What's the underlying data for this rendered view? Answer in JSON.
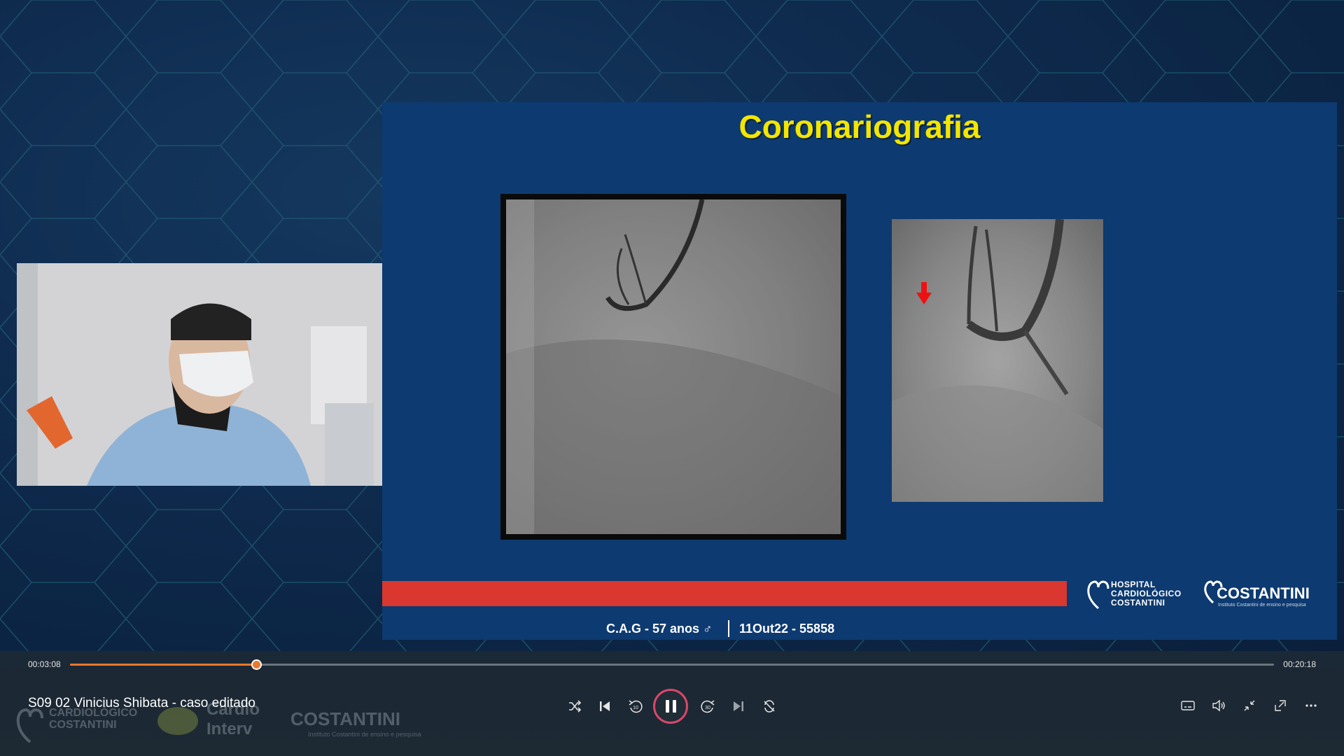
{
  "slide": {
    "title": "Coronariografia",
    "footer_left": "C.A.G - 57 anos ♂",
    "footer_right": "11Out22 - 55858",
    "logo_hospital": [
      "HOSPITAL",
      "CARDIOLÓGICO",
      "COSTANTINI"
    ],
    "logo_costantini": "COSTANTINI",
    "logo_costantini_sub": "Instituto Costantini de ensino e pesquisa",
    "accent_color": "#d9372f",
    "title_color": "#f2e600"
  },
  "player": {
    "current_time": "00:03:08",
    "total_time": "00:20:18",
    "progress": 0.1544,
    "video_title": "S09 02 Vinicius Shibata - caso editado",
    "state": "playing",
    "accent_color": "#e9792c",
    "watermark": {
      "hospital": [
        "CARDIOLÓGICO",
        "COSTANTINI"
      ],
      "cardio": [
        "Cardio",
        "Interv"
      ],
      "costantini": "COSTANTINI",
      "costantini_sub": "Instituto Costantini de ensino e pesquisa"
    },
    "controls": {
      "left": [
        "shuffle-icon",
        "previous-icon",
        "rewind-10-icon",
        "pause-icon",
        "forward-30-icon",
        "next-icon",
        "repeat-icon"
      ],
      "right": [
        "captions-icon",
        "volume-icon",
        "exit-fullscreen-icon",
        "mini-player-icon",
        "more-icon"
      ],
      "rewind_label": "10",
      "forward_label": "30"
    }
  }
}
